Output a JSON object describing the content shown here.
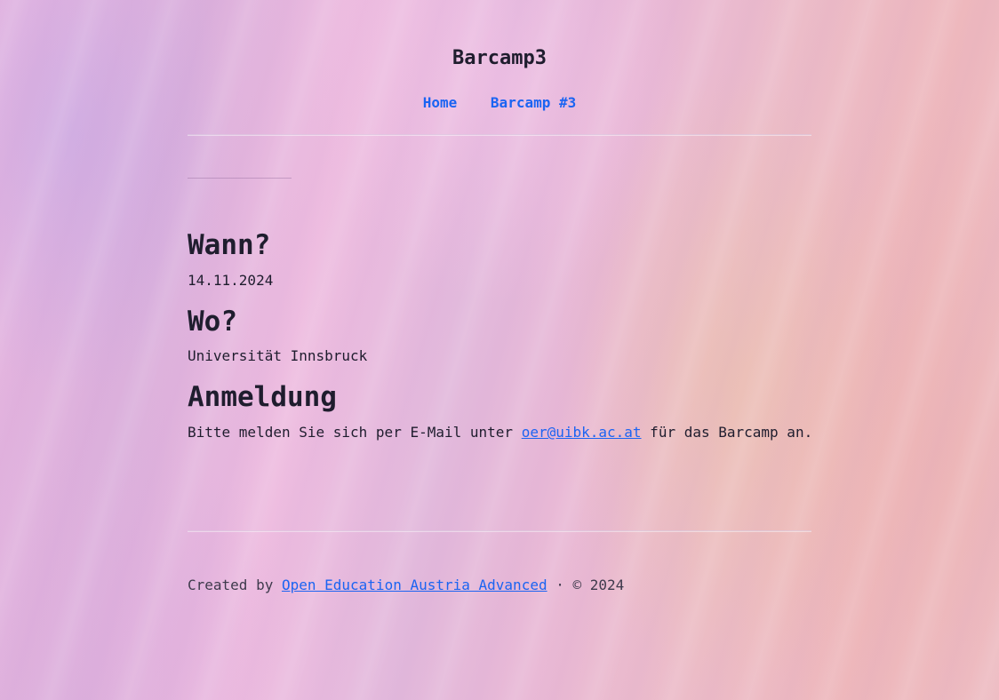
{
  "site": {
    "title": "Barcamp3"
  },
  "nav": {
    "items": [
      "Home",
      "Barcamp #3"
    ]
  },
  "sections": {
    "when": {
      "heading": "Wann?",
      "text": "14.11.2024"
    },
    "where": {
      "heading": "Wo?",
      "text": "Universität Innsbruck"
    },
    "registration": {
      "heading": "Anmeldung",
      "text_before": "Bitte melden Sie sich per E-Mail unter ",
      "email": "oer@uibk.ac.at",
      "text_after": " für das Barcamp an."
    }
  },
  "footer": {
    "prefix": "Created by ",
    "author_link": "Open Education Austria Advanced",
    "suffix": " · © 2024"
  },
  "colors": {
    "text": "#1f1d2e",
    "link": "#1b64f2"
  }
}
